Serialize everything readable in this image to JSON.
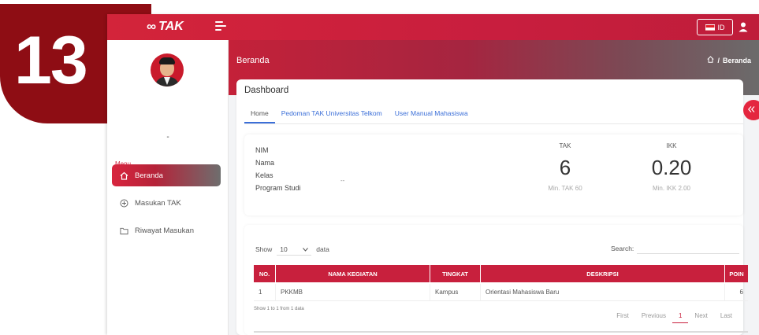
{
  "badge": {
    "number": "13"
  },
  "topbar": {
    "logo_text": "TAK",
    "lang": "ID"
  },
  "sidebar": {
    "user_name": "-",
    "menu_heading": "Menu",
    "items": [
      {
        "label": "Beranda",
        "icon": "home-icon",
        "active": true
      },
      {
        "label": "Masukan TAK",
        "icon": "plus-circle-icon",
        "active": false
      },
      {
        "label": "Riwayat Masukan",
        "icon": "folder-icon",
        "active": false
      }
    ]
  },
  "header": {
    "title": "Beranda",
    "breadcrumb_current": "Beranda",
    "breadcrumb_sep": "/"
  },
  "dashboard": {
    "title": "Dashboard",
    "tabs": [
      "Home",
      "Pedoman TAK Universitas Telkom",
      "User Manual Mahasiswa"
    ],
    "info_labels": [
      "NIM",
      "Nama",
      "Kelas",
      "Program Studi"
    ],
    "kelas_value": "--",
    "stats": {
      "tak": {
        "label": "TAK",
        "value": "6",
        "sub": "Min. TAK 60"
      },
      "ikk": {
        "label": "IKK",
        "value": "0.20",
        "sub": "Min. IKK 2.00"
      }
    }
  },
  "table": {
    "show_label": "Show",
    "show_value": "10",
    "data_label": "data",
    "search_label": "Search:",
    "columns": [
      "NO.",
      "NAMA KEGIATAN",
      "TINGKAT",
      "DESKRIPSI",
      "POIN"
    ],
    "rows": [
      {
        "no": "1",
        "nama": "PKKMB",
        "tingkat": "Kampus",
        "deskripsi": "Orientasi Mahasiswa Baru",
        "poin": "6"
      }
    ],
    "info": "Show 1 to 1 from 1 data",
    "pager": [
      "First",
      "Previous",
      "1",
      "Next",
      "Last"
    ]
  },
  "colors": {
    "accent": "#c8203d",
    "badge": "#8e0d14"
  }
}
